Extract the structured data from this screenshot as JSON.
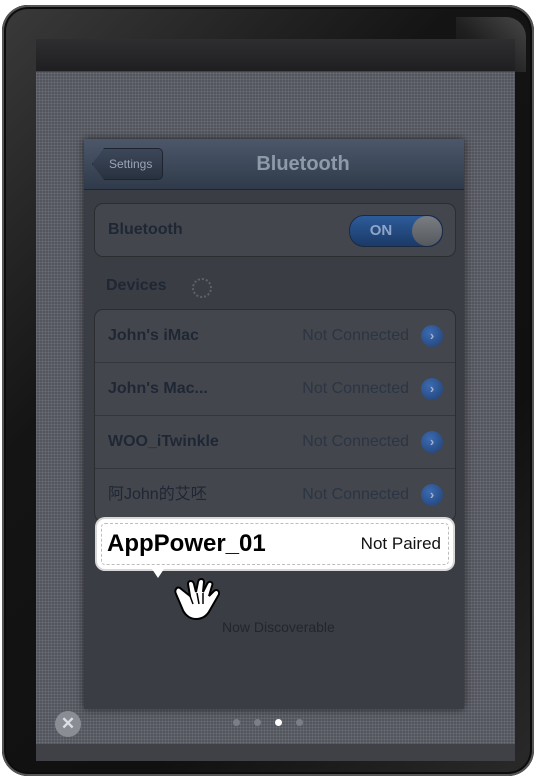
{
  "nav": {
    "back_label": "Settings",
    "title": "Bluetooth"
  },
  "bluetooth_row": {
    "label": "Bluetooth",
    "toggle_state": "ON"
  },
  "devices_section": {
    "header": "Devices",
    "items": [
      {
        "name": "John's iMac",
        "status": "Not Connected"
      },
      {
        "name": "John's Mac...",
        "status": "Not Connected"
      },
      {
        "name": "WOO_iTwinkle",
        "status": "Not Connected"
      },
      {
        "name": "阿John的艾呸",
        "status": "Not Connected"
      }
    ]
  },
  "highlight": {
    "name": "AppPower_01",
    "status": "Not Paired"
  },
  "footer_text": "Now Discoverable",
  "pager": {
    "count": 4,
    "active_index": 2
  },
  "icons": {
    "close": "close-icon",
    "chevron": "disclosure-chevron-icon",
    "pointer": "hand-pointer-icon",
    "spinner": "loading-spinner-icon"
  },
  "colors": {
    "toggle_on": "#2d5b9a",
    "navbar": "#3e4a5c",
    "highlight_bg": "#ffffff"
  }
}
